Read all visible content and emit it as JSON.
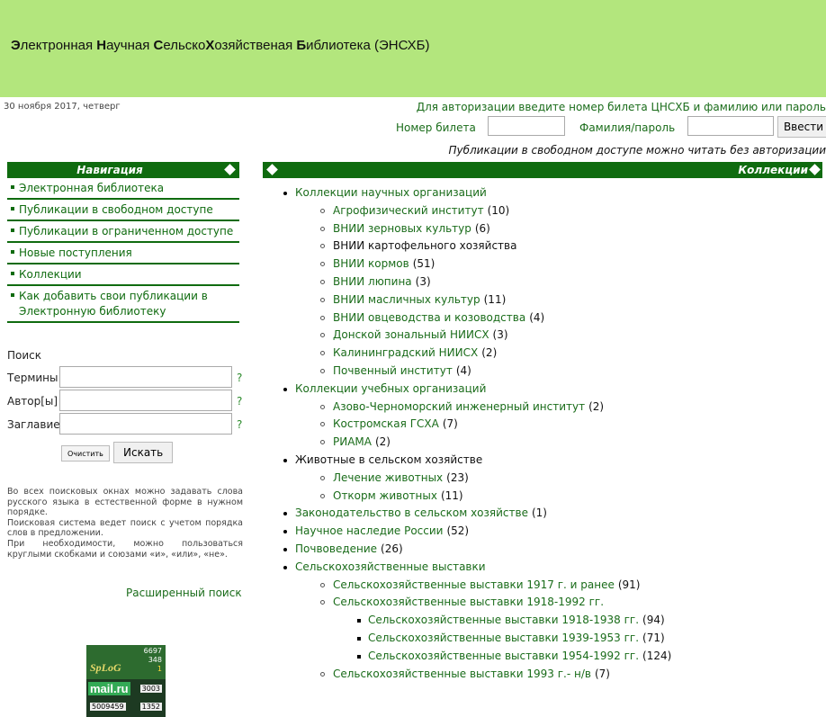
{
  "header": {
    "title_parts": [
      {
        "bold": "Э",
        "rest": "лектронная "
      },
      {
        "bold": "Н",
        "rest": "аучная "
      },
      {
        "bold": "С",
        "rest": "ельско"
      },
      {
        "bold": "Х",
        "rest": "озяйственая "
      },
      {
        "bold": "Б",
        "rest": "иблиотека (ЭНСХБ)"
      }
    ],
    "date": "30 ноября 2017, четверг",
    "auth_hint": "Для авторизации введите номер билета ЦНСХБ и фамилию или пароль",
    "ticket_label": "Номер билета",
    "ticket_value": "",
    "password_label": "Фамилия/пароль",
    "password_value": "",
    "login_button": "Ввести",
    "free_note": "Публикации в свободном доступе можно читать без авторизации"
  },
  "nav": {
    "title": "Навигация",
    "items": [
      {
        "label": "Электронная библиотека"
      },
      {
        "label": "Публикации в свободном доступе"
      },
      {
        "label": "Публикации в ограниченном доступе"
      },
      {
        "label": "Новые поступления"
      },
      {
        "label": "Коллекции"
      },
      {
        "label": "Как добавить свои публикации в",
        "label2": "Электронную библиотеку"
      }
    ]
  },
  "search": {
    "heading": "Поиск",
    "fields": [
      {
        "label": "Термины",
        "value": "",
        "help": "?"
      },
      {
        "label": "Автор[ы]",
        "value": "",
        "help": "?"
      },
      {
        "label": "Заглавие",
        "value": "",
        "help": "?"
      }
    ],
    "clear_button": "Очистить",
    "find_button": "Искать",
    "help_lines": [
      "Во всех поисковых окнах можно задавать слова русского языка в естественной форме в нужном порядке.",
      "Поисковая система ведет поиск с учетом порядка слов в предложении.",
      "При необходимости, можно пользоваться круглыми скобками и союзами «и», «или», «не»."
    ],
    "advanced_link": "Расширенный поиск"
  },
  "counter": {
    "n1": "6697",
    "n2": "348",
    "n3": "1",
    "logo": "SpLoG",
    "mail": "mail.ru",
    "b1": "3003",
    "b2": "5009459",
    "b3": "1352"
  },
  "collections": {
    "title": "Коллекции",
    "tree": [
      {
        "level": 0,
        "text": "Коллекции научных организаций",
        "link": true
      },
      {
        "level": 1,
        "text": "Агрофизический институт",
        "count": "(10)",
        "link": true
      },
      {
        "level": 1,
        "text": "ВНИИ зерновых культур",
        "count": "(6)",
        "link": true
      },
      {
        "level": 1,
        "text": "ВНИИ картофельного хозяйства",
        "count": "",
        "link": false
      },
      {
        "level": 1,
        "text": "ВНИИ кормов",
        "count": "(51)",
        "link": true
      },
      {
        "level": 1,
        "text": "ВНИИ люпина",
        "count": "(3)",
        "link": true
      },
      {
        "level": 1,
        "text": "ВНИИ масличных культур",
        "count": "(11)",
        "link": true
      },
      {
        "level": 1,
        "text": "ВНИИ овцеводства и козоводства",
        "count": "(4)",
        "link": true
      },
      {
        "level": 1,
        "text": "Донской зональный НИИСХ",
        "count": "(3)",
        "link": true
      },
      {
        "level": 1,
        "text": "Калининградский НИИСХ",
        "count": "(2)",
        "link": true
      },
      {
        "level": 1,
        "text": "Почвенный институт",
        "count": "(4)",
        "link": true
      },
      {
        "level": 0,
        "text": "Коллекции учебных организаций",
        "link": true
      },
      {
        "level": 1,
        "text": "Азово-Черноморский инженерный институт",
        "count": "(2)",
        "link": true
      },
      {
        "level": 1,
        "text": "Костромская ГСХА",
        "count": "(7)",
        "link": true
      },
      {
        "level": 1,
        "text": "РИАМА",
        "count": "(2)",
        "link": true
      },
      {
        "level": 0,
        "text": "Животные в сельском хозяйстве",
        "link": false
      },
      {
        "level": 1,
        "text": "Лечение животных",
        "count": "(23)",
        "link": true
      },
      {
        "level": 1,
        "text": "Откорм животных",
        "count": "(11)",
        "link": true
      },
      {
        "level": 0,
        "text": "Законодательство в сельском хозяйстве",
        "count": "(1)",
        "link": true
      },
      {
        "level": 0,
        "text": "Научное наследие России",
        "count": "(52)",
        "link": true
      },
      {
        "level": 0,
        "text": "Почвоведение",
        "count": "(26)",
        "link": true
      },
      {
        "level": 0,
        "text": "Сельскохозяйственные выставки",
        "link": true
      },
      {
        "level": 1,
        "text": "Сельскохозяйственные выставки 1917 г. и ранее",
        "count": "(91)",
        "link": true
      },
      {
        "level": 1,
        "text": "Сельскохозяйственные выставки 1918-1992 гг.",
        "count": "",
        "link": true
      },
      {
        "level": 2,
        "text": "Сельскохозяйственные выставки 1918-1938 гг.",
        "count": "(94)",
        "link": true
      },
      {
        "level": 2,
        "text": "Сельскохозяйственные выставки 1939-1953 гг.",
        "count": "(71)",
        "link": true
      },
      {
        "level": 2,
        "text": "Сельскохозяйственные выставки 1954-1992 гг.",
        "count": "(124)",
        "link": true
      },
      {
        "level": 1,
        "text": "Сельскохозяйственные выставки 1993 г.- н/в",
        "count": "(7)",
        "link": true
      }
    ]
  },
  "colors": {
    "header_bg": "#b3e67d",
    "bar_bg": "#0f6b0f",
    "link": "#1a6c1a"
  }
}
